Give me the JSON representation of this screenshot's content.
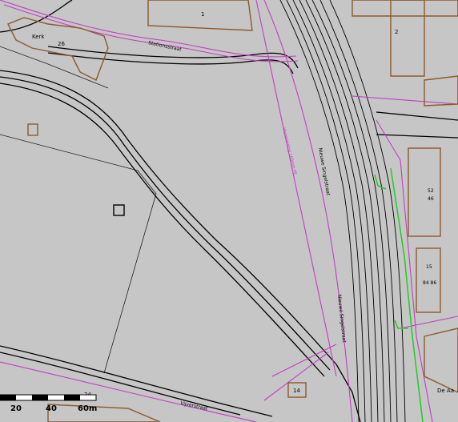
{
  "map": {
    "colors": {
      "background": "#c6c6c6",
      "road": "#000000",
      "parcel": "#c9c9c9",
      "building": "#8b5a2b",
      "cable": "#c040c0",
      "green": "#22cc22"
    },
    "labels": {
      "kerk": "Kerk",
      "num_26": "26",
      "num_1": "1",
      "num_2": "2",
      "num_24": "24",
      "num_14": "14",
      "street_top": "Stationsstraat",
      "street_rail": "Nieuwe Singelstraat",
      "street_rail2": "Nieuwe Singelstraat",
      "street_bottom": "Vijverstraat",
      "street_dea": "De Aa",
      "pipe_note": "Waterleiding 160mm PE",
      "num_84_86": "84 86",
      "num_15": "15",
      "num_52": "52",
      "num_46": "46"
    },
    "scale_bar": {
      "ticks": [
        "20",
        "40",
        "60m"
      ]
    }
  }
}
